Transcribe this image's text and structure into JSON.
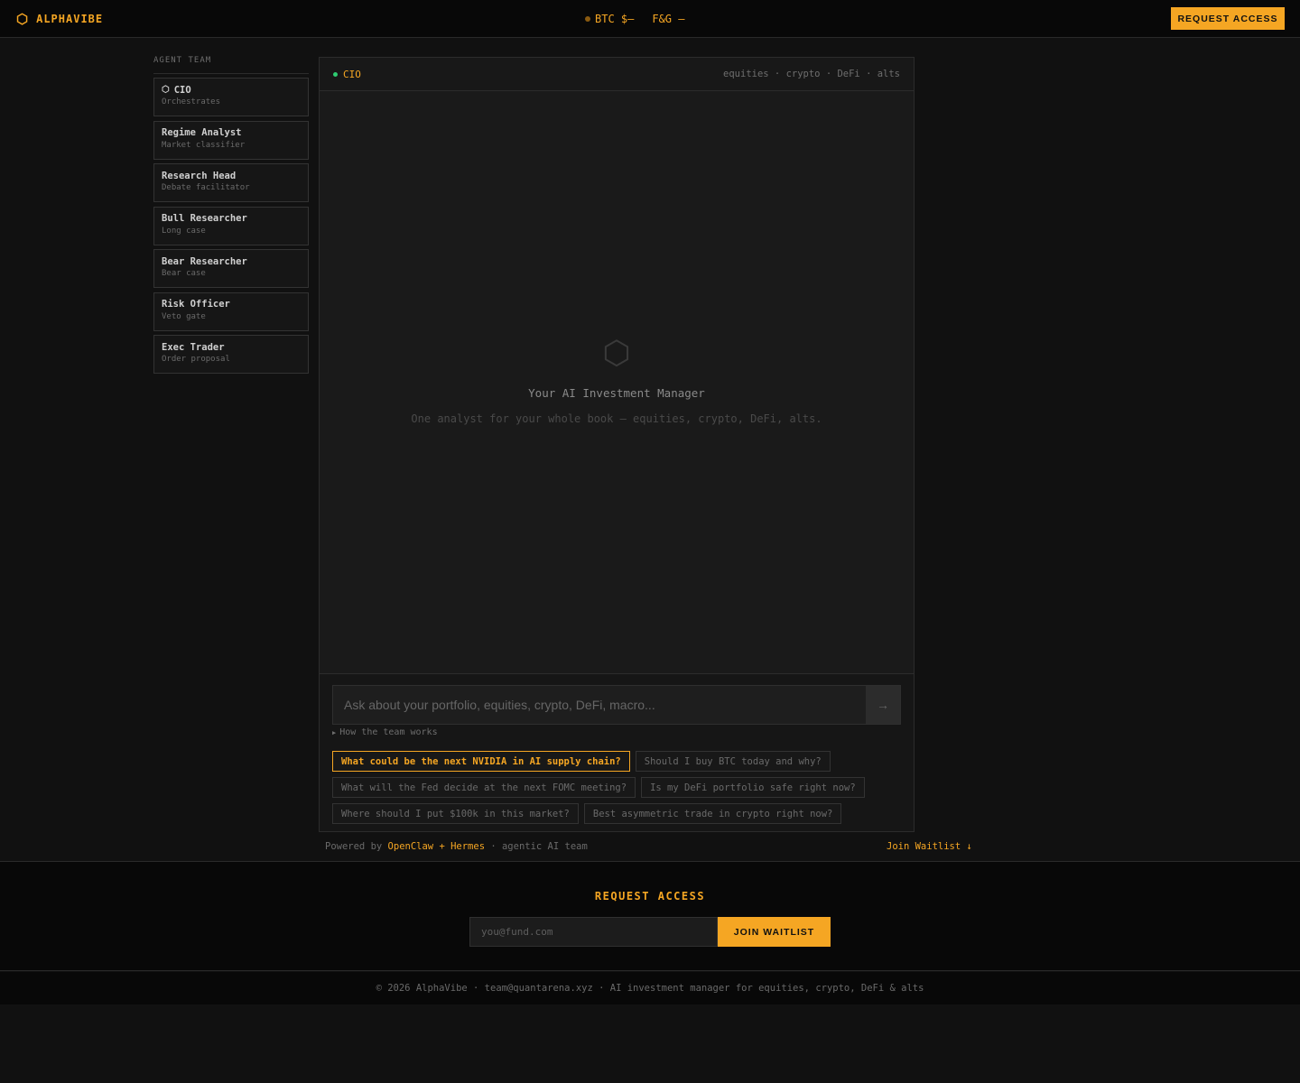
{
  "header": {
    "brand_icon": "hexagon-icon",
    "brand": "ALPHAVIBE",
    "ticker": {
      "btc": "BTC $—",
      "fng": "F&G —"
    },
    "cta": "REQUEST ACCESS"
  },
  "sidebar": {
    "title": "AGENT TEAM",
    "agents": [
      {
        "name": "CIO",
        "role": "Orchestrates",
        "icon": "hexagon-icon"
      },
      {
        "name": "Regime Analyst",
        "role": "Market classifier"
      },
      {
        "name": "Research Head",
        "role": "Debate facilitator"
      },
      {
        "name": "Bull Researcher",
        "role": "Long case"
      },
      {
        "name": "Bear Researcher",
        "role": "Bear case"
      },
      {
        "name": "Risk Officer",
        "role": "Veto gate"
      },
      {
        "name": "Exec Trader",
        "role": "Order proposal"
      }
    ]
  },
  "chat": {
    "agent": "CIO",
    "tags": "equities · crypto · DeFi · alts",
    "empty_title": "Your AI Investment Manager",
    "empty_sub": "One analyst for your whole book — equities, crypto, DeFi, alts.",
    "input_placeholder": "Ask about your portfolio, equities, crypto, DeFi, macro...",
    "send": "→",
    "how_works": "How the team works",
    "suggestions": [
      "What could be the next NVIDIA in AI supply chain?",
      "Should I buy BTC today and why?",
      "What will the Fed decide at the next FOMC meeting?",
      "Is my DeFi portfolio safe right now?",
      "Where should I put $100k in this market?",
      "Best asymmetric trade in crypto right now?"
    ]
  },
  "powered": {
    "prefix": "Powered by ",
    "link": "OpenClaw + Hermes",
    "suffix": " · agentic AI team",
    "join": "Join Waitlist ↓"
  },
  "waitlist": {
    "title": "REQUEST ACCESS",
    "placeholder": "you@fund.com",
    "button": "JOIN WAITLIST"
  },
  "footer": {
    "text": "© 2026 AlphaVibe · team@quantarena.xyz · AI investment manager for equities, crypto, DeFi & alts"
  },
  "colors": {
    "accent": "#f5a623",
    "status_green": "#2ecc71",
    "background": "#111111"
  }
}
